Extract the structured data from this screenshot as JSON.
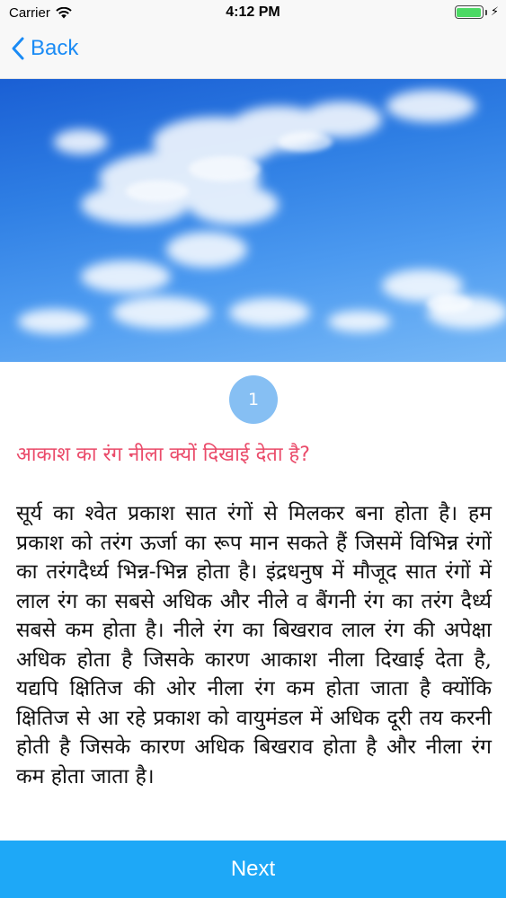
{
  "status_bar": {
    "carrier": "Carrier",
    "time": "4:12 PM",
    "wifi_icon": "wifi-icon",
    "battery_icon": "battery-icon",
    "charging_icon": "charging-bolt-icon"
  },
  "nav": {
    "back_label": "Back",
    "back_icon": "chevron-left-icon"
  },
  "hero": {
    "image": "blue-sky-clouds-image"
  },
  "content": {
    "step_number": "1",
    "question": "आकाश का रंग नीला क्यों दिखाई देता है?",
    "answer": "सूर्य का श्वेत प्रकाश सात रंगों से मिलकर बना होता है। हम प्रकाश को तरंग ऊर्जा का रूप मान सकते हैं जिसमें विभिन्न रंगों का तरंगदैर्ध्य भिन्न-भिन्न होता है। इंद्रधनुष में मौजूद सात रंगों में लाल रंग का सबसे अधिक और नीले व बैंगनी रंग का तरंग दैर्ध्य सबसे कम होता है। नीले रंग का बिखराव लाल रंग की अपेक्षा अधिक होता है जिसके कारण आकाश नीला दिखाई देता है, यद्यपि क्षितिज की ओर नीला रंग कम होता जाता है क्योंकि क्षितिज से आ रहे प्रकाश को वायुमंडल में अधिक दूरी तय करनी होती है जिसके कारण अधिक बिखराव होता है और नीला रंग कम होता जाता है।"
  },
  "footer": {
    "next_label": "Next"
  },
  "colors": {
    "accent": "#1a8bf5",
    "question": "#ea4b6a",
    "next_button": "#1ea8f7",
    "badge": "#86bff3"
  }
}
